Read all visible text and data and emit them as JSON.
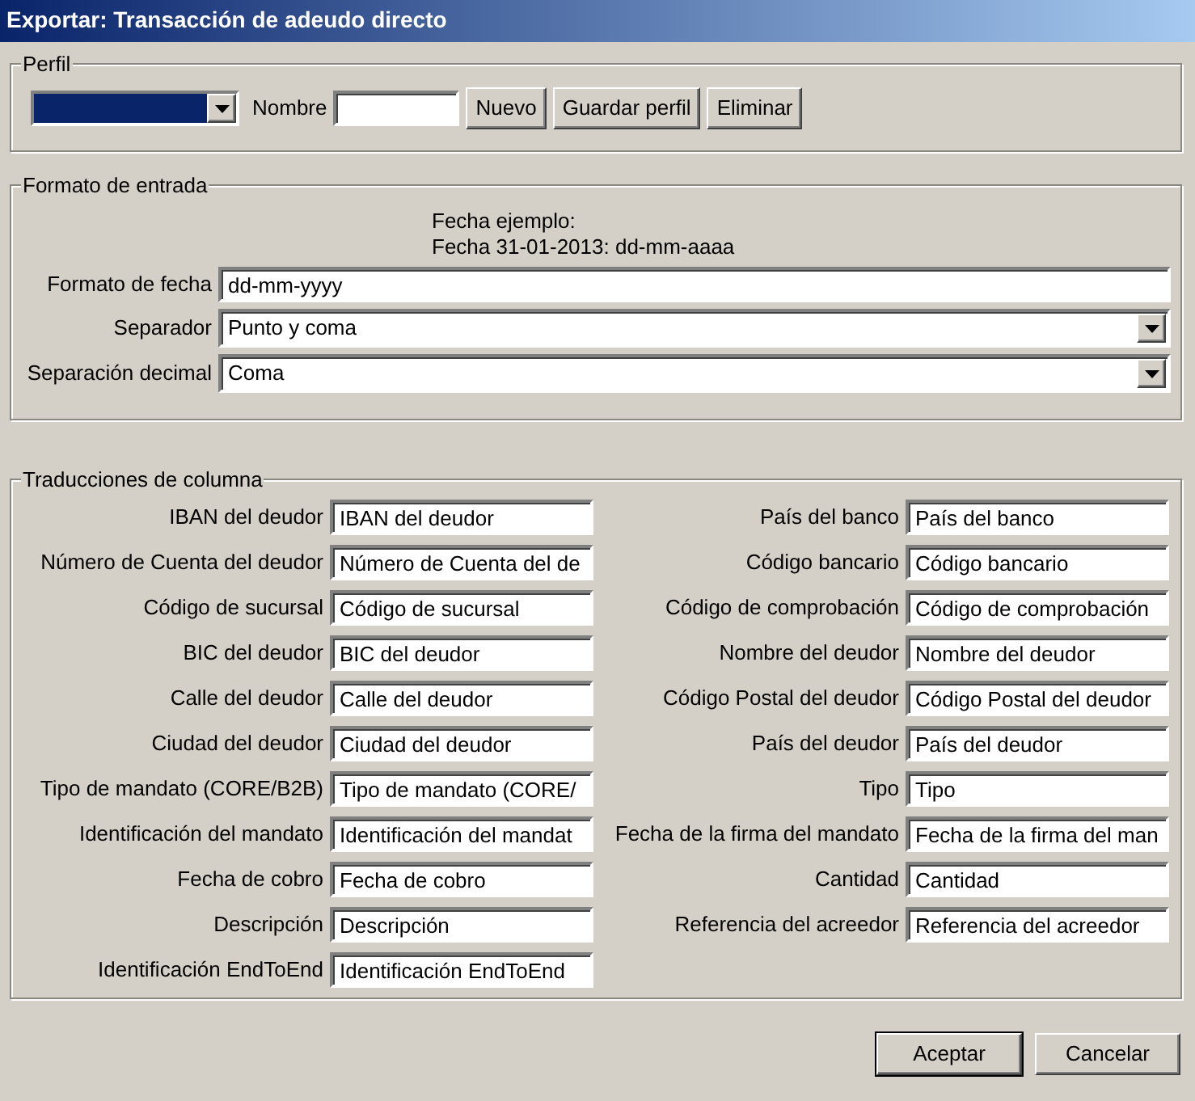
{
  "window": {
    "title": "Exportar: Transacción de adeudo directo"
  },
  "profile": {
    "legend": "Perfil",
    "select": {
      "highlighted": true
    },
    "name_label": "Nombre",
    "buttons": [
      "Nuevo",
      "Guardar perfil",
      "Eliminar"
    ]
  },
  "input_format": {
    "legend": "Formato de entrada",
    "example_lines": [
      "Fecha ejemplo:",
      "Fecha 31-01-2013: dd-mm-aaaa"
    ],
    "fields": [
      {
        "label": "Formato de fecha",
        "kind": "text",
        "value": "dd-mm-yyyy"
      },
      {
        "label": "Separador",
        "kind": "select",
        "value": "Punto y coma"
      },
      {
        "label": "Separación decimal",
        "kind": "select",
        "value": "Coma"
      }
    ]
  },
  "column_translations": {
    "legend": "Traducciones de columna",
    "left": [
      {
        "label": "IBAN del deudor",
        "value": "IBAN del deudor"
      },
      {
        "label": "Número de Cuenta del deudor",
        "value": "Número de Cuenta del de"
      },
      {
        "label": "Código de sucursal",
        "value": "Código de sucursal"
      },
      {
        "label": "BIC del deudor",
        "value": "BIC del deudor"
      },
      {
        "label": "Calle del deudor",
        "value": "Calle del deudor"
      },
      {
        "label": "Ciudad del deudor",
        "value": "Ciudad del deudor"
      },
      {
        "label": "Tipo de mandato (CORE/B2B)",
        "value": "Tipo de mandato (CORE/"
      },
      {
        "label": "Identificación del mandato",
        "value": "Identificación del mandat"
      },
      {
        "label": "Fecha de cobro",
        "value": "Fecha de cobro"
      },
      {
        "label": "Descripción",
        "value": "Descripción"
      },
      {
        "label": "Identificación EndToEnd",
        "value": "Identificación EndToEnd"
      }
    ],
    "right": [
      {
        "label": "País del banco",
        "value": "País del banco"
      },
      {
        "label": "Código bancario",
        "value": "Código bancario"
      },
      {
        "label": "Código de comprobación",
        "value": "Código de comprobación"
      },
      {
        "label": "Nombre del deudor",
        "value": "Nombre del deudor"
      },
      {
        "label": "Código Postal del deudor",
        "value": "Código Postal del deudor"
      },
      {
        "label": "País del deudor",
        "value": "País del deudor"
      },
      {
        "label": "Tipo",
        "value": "Tipo"
      },
      {
        "label": "Fecha de la firma del mandato",
        "value": "Fecha de la firma del man"
      },
      {
        "label": "Cantidad",
        "value": "Cantidad"
      },
      {
        "label": "Referencia del acreedor",
        "value": "Referencia del acreedor"
      }
    ]
  },
  "buttons": [
    {
      "label": "Aceptar",
      "default": true
    },
    {
      "label": "Cancelar",
      "default": false
    }
  ]
}
